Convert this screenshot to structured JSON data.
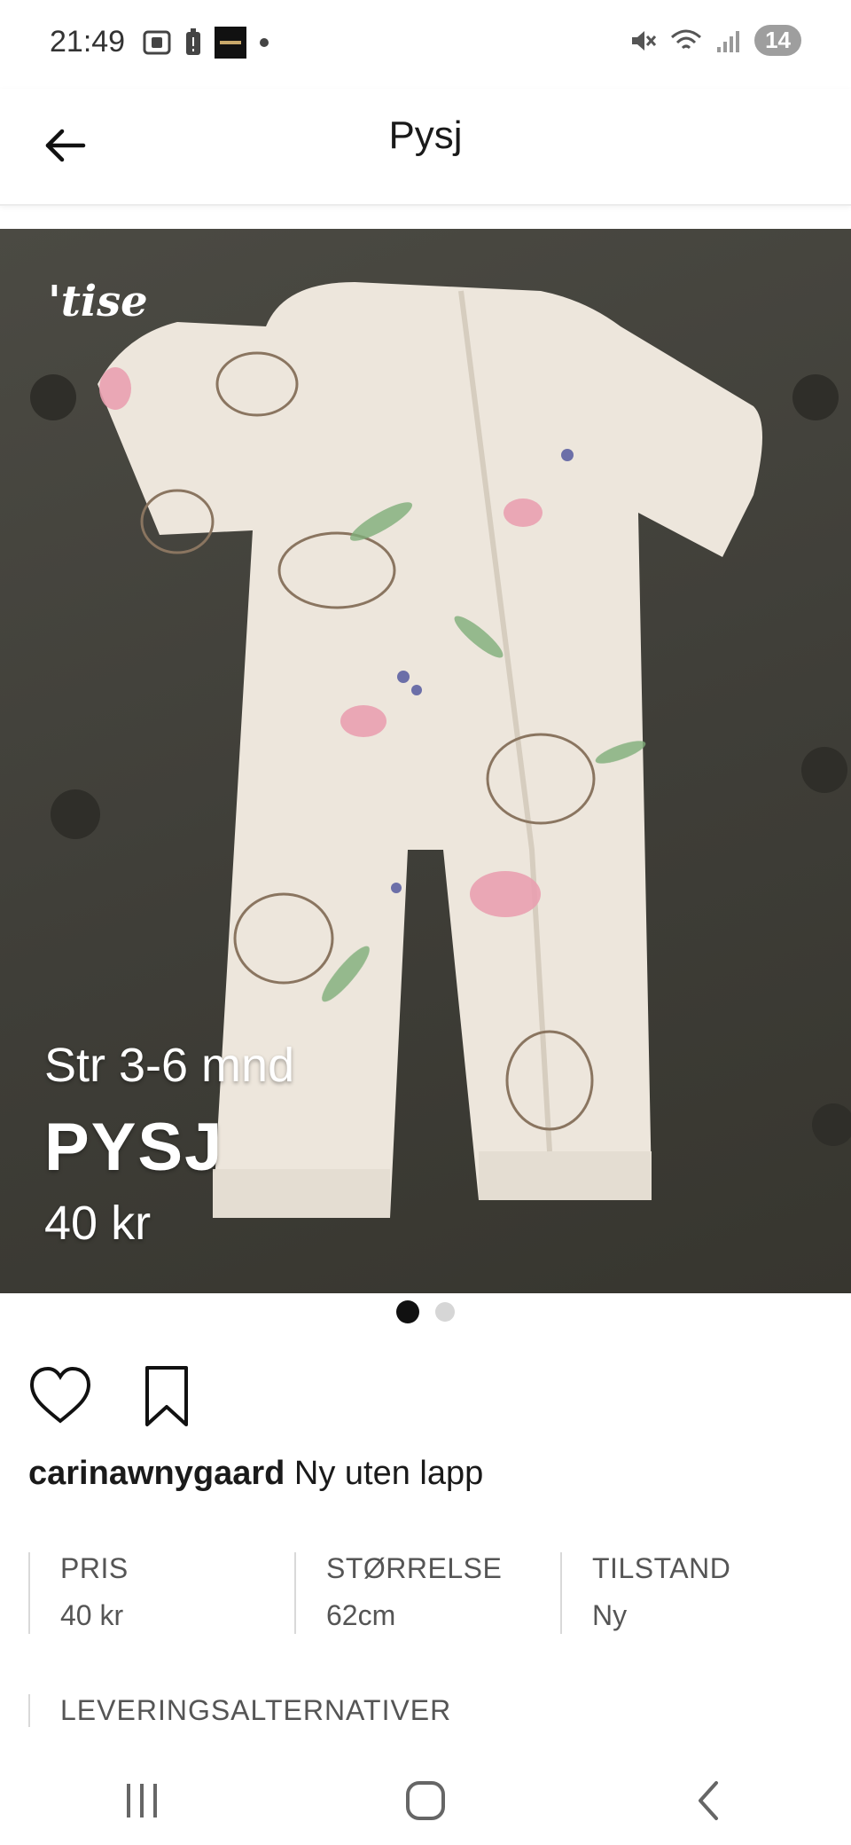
{
  "status_bar": {
    "time": "21:49",
    "notification_count": "14",
    "icons_left": [
      "screenshot-icon",
      "battery-alert-icon",
      "app-thumbnail-icon",
      "dot-icon"
    ],
    "icons_right": [
      "mute-icon",
      "wifi-icon",
      "signal-icon"
    ]
  },
  "header": {
    "title": "Pysj",
    "back_icon": "arrow-left-icon"
  },
  "image": {
    "logo": "'tise",
    "overlay_size": "Str 3-6 mnd",
    "overlay_title": "PYSJ",
    "overlay_price": "40 kr",
    "page_count": 2,
    "active_page": 1
  },
  "actions": {
    "like_icon": "heart-icon",
    "save_icon": "bookmark-icon"
  },
  "caption": {
    "username": "carinawnygaard",
    "text": " Ny uten lapp"
  },
  "attributes": [
    {
      "label": "PRIS",
      "value": "40 kr"
    },
    {
      "label": "STØRRELSE",
      "value": "62cm"
    },
    {
      "label": "TILSTAND",
      "value": "Ny"
    }
  ],
  "delivery_label": "LEVERINGSALTERNATIVER",
  "colors": {
    "text": "#1a1a1a",
    "muted": "#555555",
    "background": "#ffffff",
    "image_bg": "#3f3e38"
  }
}
